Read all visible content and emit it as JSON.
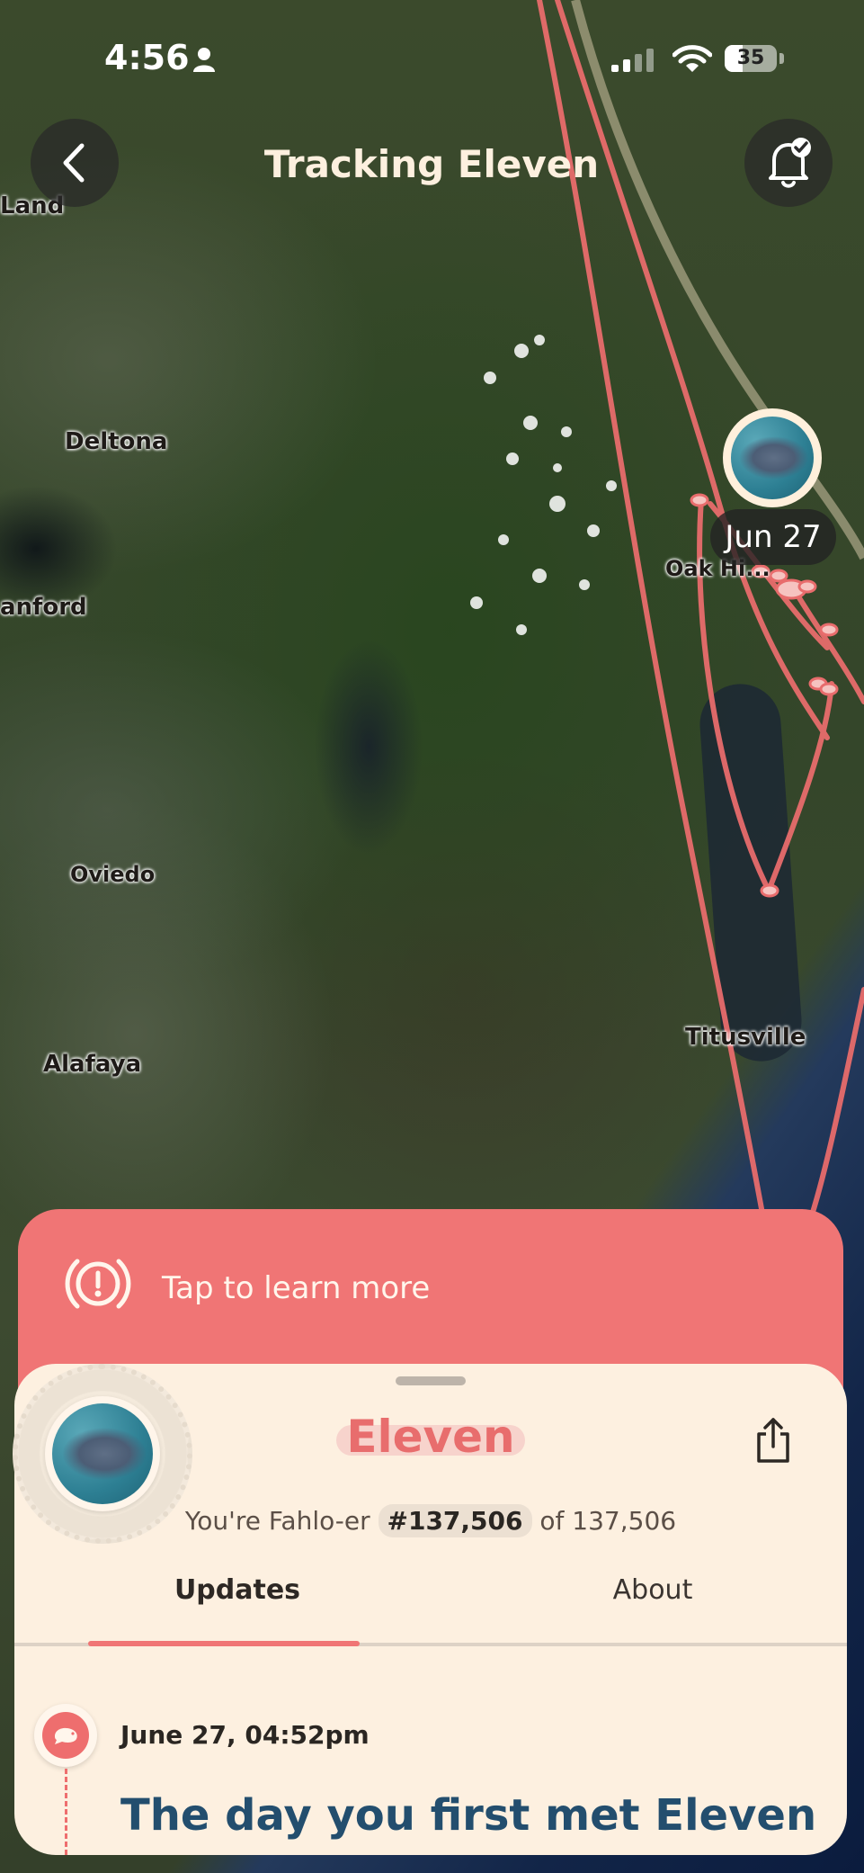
{
  "status_bar": {
    "time": "4:56",
    "battery": "35",
    "battery_level": 0.35
  },
  "header": {
    "title": "Tracking Eleven"
  },
  "map": {
    "cities": [
      "Land",
      "Deltona",
      "anford",
      "Oviedo",
      "Alafaya",
      "Oak Hi...",
      "Titusville"
    ],
    "pin_date": "Jun 27",
    "track_color": "#e86c6c"
  },
  "alert": {
    "text": "Tap to learn more"
  },
  "profile": {
    "name": "Eleven",
    "rank_prefix": "You're Fahlo-er",
    "rank_number": "#137,506",
    "rank_suffix": "of 137,506"
  },
  "tabs": [
    {
      "label": "Updates",
      "active": true
    },
    {
      "label": "About",
      "active": false
    }
  ],
  "update": {
    "date": "June 27, 04:52pm",
    "title": "The day you first met Eleven"
  },
  "colors": {
    "accent": "#f07575",
    "sheet_bg": "#fdf0e0",
    "title_blue": "#234e6e"
  }
}
